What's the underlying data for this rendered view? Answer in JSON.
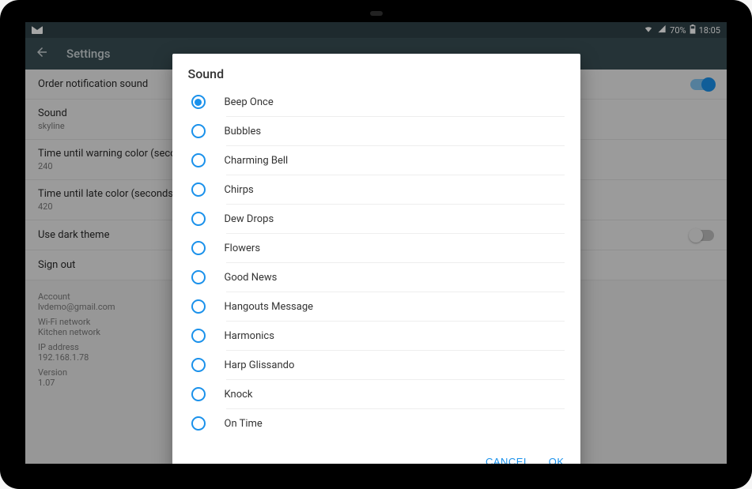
{
  "status_bar": {
    "battery_text": "70%",
    "time": "18:05"
  },
  "app_bar": {
    "title": "Settings"
  },
  "settings": [
    {
      "title": "Order notification sound",
      "sub": "",
      "switch": "on"
    },
    {
      "title": "Sound",
      "sub": "skyline",
      "switch": null
    },
    {
      "title": "Time until warning color (seconds)",
      "sub": "240",
      "switch": null
    },
    {
      "title": "Time until late color (seconds)",
      "sub": "420",
      "switch": null
    },
    {
      "title": "Use dark theme",
      "sub": "",
      "switch": "off"
    },
    {
      "title": "Sign out",
      "sub": "",
      "switch": null
    }
  ],
  "info": {
    "account_label": "Account",
    "account_value": "lvdemo@gmail.com",
    "wifi_label": "Wi-Fi network",
    "wifi_value": "Kitchen network",
    "ip_label": "IP address",
    "ip_value": "192.168.1.78",
    "version_label": "Version",
    "version_value": "1.07"
  },
  "dialog": {
    "title": "Sound",
    "options": [
      {
        "label": "Beep Once",
        "selected": true
      },
      {
        "label": "Bubbles",
        "selected": false
      },
      {
        "label": "Charming Bell",
        "selected": false
      },
      {
        "label": "Chirps",
        "selected": false
      },
      {
        "label": "Dew Drops",
        "selected": false
      },
      {
        "label": "Flowers",
        "selected": false
      },
      {
        "label": "Good News",
        "selected": false
      },
      {
        "label": "Hangouts Message",
        "selected": false
      },
      {
        "label": "Harmonics",
        "selected": false
      },
      {
        "label": "Harp Glissando",
        "selected": false
      },
      {
        "label": "Knock",
        "selected": false
      },
      {
        "label": "On Time",
        "selected": false
      }
    ],
    "cancel": "CANCEL",
    "ok": "OK"
  }
}
